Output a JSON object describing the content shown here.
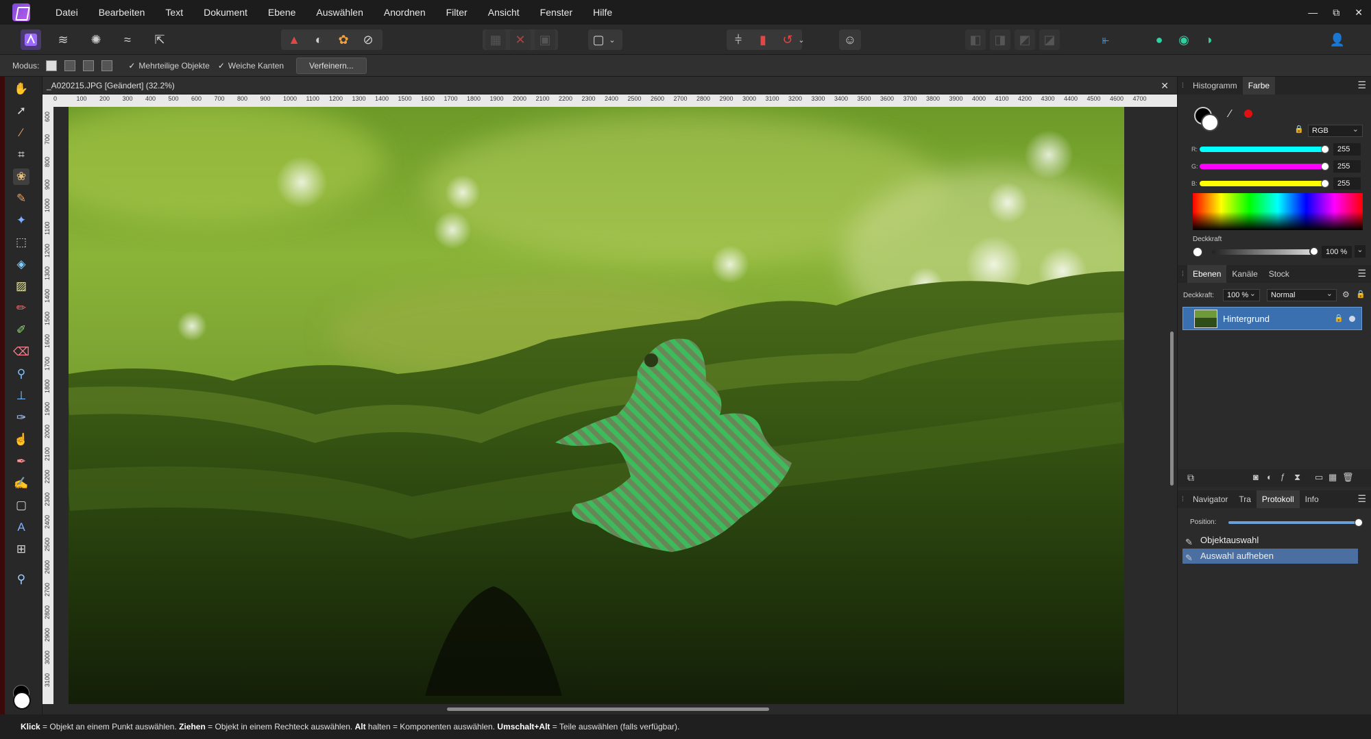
{
  "menubar": {
    "items": [
      "Datei",
      "Bearbeiten",
      "Text",
      "Dokument",
      "Ebene",
      "Auswählen",
      "Anordnen",
      "Filter",
      "Ansicht",
      "Fenster",
      "Hilfe"
    ],
    "controls": {
      "minimize": "—",
      "restore": "⧉",
      "close": "✕"
    }
  },
  "context_toolbar": {
    "mode_label": "Modus:",
    "multipart_label": "Mehrteilige Objekte",
    "soft_edges_label": "Weiche Kanten",
    "refine_label": "Verfeinern..."
  },
  "document": {
    "tab_title": "_A020215.JPG [Geändert] (32.2%)",
    "close": "✕",
    "ruler_unit": "px",
    "top_ruler": [
      "0",
      "100",
      "200",
      "300",
      "400",
      "500",
      "600",
      "700",
      "800",
      "900",
      "1000",
      "1100",
      "1200",
      "1300",
      "1400",
      "1500",
      "1600",
      "1700",
      "1800",
      "1900",
      "2000",
      "2100",
      "2200",
      "2300",
      "2400",
      "2500",
      "2600",
      "2700",
      "2800",
      "2900",
      "3000",
      "3100",
      "3200",
      "3300",
      "3400",
      "3500",
      "3600",
      "3700",
      "3800",
      "3900",
      "4000",
      "4100",
      "4200",
      "4300",
      "4400",
      "4500",
      "4600",
      "4700"
    ],
    "left_ruler": [
      "600",
      "700",
      "800",
      "900",
      "1000",
      "1100",
      "1200",
      "1300",
      "1400",
      "1500",
      "1600",
      "1700",
      "1800",
      "1900",
      "2000",
      "2100",
      "2200",
      "2300",
      "2400",
      "2500",
      "2600",
      "2700",
      "2800",
      "2900",
      "3000",
      "3100"
    ]
  },
  "color_panel": {
    "tabs": [
      "Histogramm",
      "Farbe"
    ],
    "selected_tab": "Farbe",
    "model": "RGB",
    "r_label": "R:",
    "r_value": "255",
    "g_label": "G:",
    "g_value": "255",
    "b_label": "B:",
    "b_value": "255",
    "opacity_label": "Deckkraft",
    "opacity_value": "100 %"
  },
  "layers_panel": {
    "tabs": [
      "Ebenen",
      "Kanäle",
      "Stock"
    ],
    "selected_tab": "Ebenen",
    "opacity_label": "Deckkraft:",
    "opacity_value": "100 %",
    "blend_mode": "Normal",
    "layers": [
      {
        "name": "Hintergrund"
      }
    ]
  },
  "history_panel": {
    "tabs": [
      "Navigator",
      "Tra",
      "Protokoll",
      "Info"
    ],
    "selected_tab": "Protokoll",
    "position_label": "Position:",
    "items": [
      {
        "label": "Objektauswahl"
      },
      {
        "label": "Auswahl aufheben"
      }
    ],
    "selected_item": "Auswahl aufheben"
  },
  "statusbar": {
    "k1": "Klick",
    "t1": " = Objekt an einem Punkt auswählen. ",
    "k2": "Ziehen",
    "t2": " = Objekt in einem Rechteck auswählen. ",
    "k3": "Alt",
    "t3": " halten = Komponenten auswählen. ",
    "k4": "Umschalt+Alt",
    "t4": " = Teile auswählen (falls verfügbar)."
  },
  "colors": {
    "accent": "#3a6fb0",
    "brand": "#7b4bd6",
    "toolbar_bg": "#2b2b2b",
    "menubar_bg": "#1c1c1c"
  }
}
